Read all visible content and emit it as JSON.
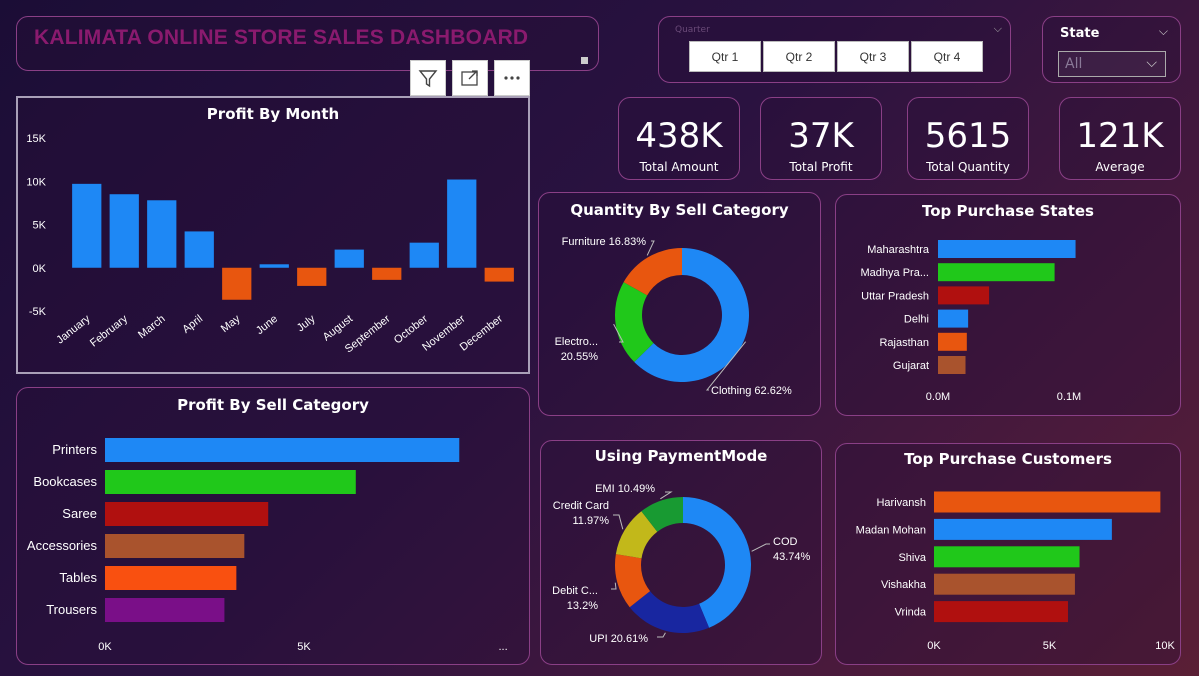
{
  "header": {
    "title": "KALIMATA ONLINE STORE SALES DASHBOARD"
  },
  "toolbar": {
    "icons": [
      "filter-icon",
      "focus-mode-icon",
      "more-options-icon"
    ]
  },
  "quarter_slicer": {
    "label": "Quarter",
    "options": [
      "Qtr 1",
      "Qtr 2",
      "Qtr 3",
      "Qtr 4"
    ]
  },
  "state_slicer": {
    "label": "State",
    "selected": "All"
  },
  "kpis": [
    {
      "value": "438K",
      "label": "Total Amount"
    },
    {
      "value": "37K",
      "label": "Total Profit"
    },
    {
      "value": "5615",
      "label": "Total Quantity"
    },
    {
      "value": "121K",
      "label": "Average"
    }
  ],
  "colors": {
    "blue": "#1e88f5",
    "orange": "#e8560f",
    "green": "#20c81a",
    "dark_red": "#b0100f",
    "brown": "#a9532d",
    "red_orange": "#f95010",
    "purple": "#7a0f88",
    "dark_blue": "#1826a0",
    "olive": "#c2b81a",
    "green2": "#189a32"
  },
  "chart_data": [
    {
      "id": "profit_by_month",
      "type": "bar",
      "title": "Profit By Month",
      "categories": [
        "January",
        "February",
        "March",
        "April",
        "May",
        "June",
        "July",
        "August",
        "September",
        "October",
        "November",
        "December"
      ],
      "values": [
        9700,
        8500,
        7800,
        4200,
        -3700,
        400,
        -2100,
        2100,
        -1400,
        2900,
        10200,
        -1600
      ],
      "ylim": [
        -5000,
        15000
      ],
      "yticks": [
        "-5K",
        "0K",
        "5K",
        "10K",
        "15K"
      ],
      "ytick_values": [
        -5000,
        0,
        5000,
        10000,
        15000
      ],
      "positive_color": "#1e88f5",
      "negative_color": "#e8560f"
    },
    {
      "id": "profit_by_sell_category",
      "type": "bar",
      "orientation": "horizontal",
      "title": "Profit By Sell Category",
      "categories": [
        "Printers",
        "Bookcases",
        "Saree",
        "Accessories",
        "Tables",
        "Trousers"
      ],
      "values": [
        8900,
        6300,
        4100,
        3500,
        3300,
        3000
      ],
      "colors": [
        "#1e88f5",
        "#20c81a",
        "#b0100f",
        "#a9532d",
        "#f95010",
        "#7a0f88"
      ],
      "xticks": [
        "0K",
        "5K",
        "..."
      ],
      "xtick_values": [
        0,
        5000,
        10000
      ],
      "xlim": [
        0,
        10300
      ]
    },
    {
      "id": "quantity_by_sell_category",
      "type": "pie",
      "title": "Quantity By Sell Category",
      "labels": [
        "Clothing",
        "Electro...",
        "Furniture"
      ],
      "values": [
        62.62,
        20.55,
        16.83
      ],
      "display": [
        "Clothing 62.62%",
        "Electro... 20.55%",
        "Furniture 16.83%"
      ],
      "colors": [
        "#1e88f5",
        "#20c81a",
        "#e8560f"
      ]
    },
    {
      "id": "using_payment_mode",
      "type": "pie",
      "title": "Using PaymentMode",
      "labels": [
        "COD",
        "UPI",
        "Debit C...",
        "Credit Card",
        "EMI"
      ],
      "values": [
        43.74,
        20.61,
        13.2,
        11.97,
        10.49
      ],
      "display": [
        "COD 43.74%",
        "UPI 20.61%",
        "Debit C... 13.2%",
        "Credit Card 11.97%",
        "EMI 10.49%"
      ],
      "colors": [
        "#1e88f5",
        "#1826a0",
        "#e8560f",
        "#c2b81a",
        "#189a32"
      ]
    },
    {
      "id": "top_purchase_states",
      "type": "bar",
      "orientation": "horizontal",
      "title": "Top Purchase States",
      "categories": [
        "Maharashtra",
        "Madhya Pra...",
        "Uttar Pradesh",
        "Delhi",
        "Rajasthan",
        "Gujarat"
      ],
      "values": [
        105000,
        89000,
        39000,
        23000,
        22000,
        21000
      ],
      "colors": [
        "#1e88f5",
        "#20c81a",
        "#b0100f",
        "#1e88f5",
        "#e8560f",
        "#a9532d"
      ],
      "xticks": [
        "0.0M",
        "0.1M"
      ],
      "xtick_values": [
        0,
        100000
      ],
      "xlim": [
        0,
        200000
      ]
    },
    {
      "id": "top_purchase_customers",
      "type": "bar",
      "orientation": "horizontal",
      "title": "Top Purchase Customers",
      "categories": [
        "Harivansh",
        "Madan Mohan",
        "Shiva",
        "Vishakha",
        "Vrinda"
      ],
      "values": [
        9800,
        7700,
        6300,
        6100,
        5800
      ],
      "colors": [
        "#e8560f",
        "#1e88f5",
        "#20c81a",
        "#a9532d",
        "#b0100f"
      ],
      "xticks": [
        "0K",
        "5K",
        "10K"
      ],
      "xtick_values": [
        0,
        5000,
        10000
      ],
      "xlim": [
        0,
        10000
      ]
    }
  ]
}
